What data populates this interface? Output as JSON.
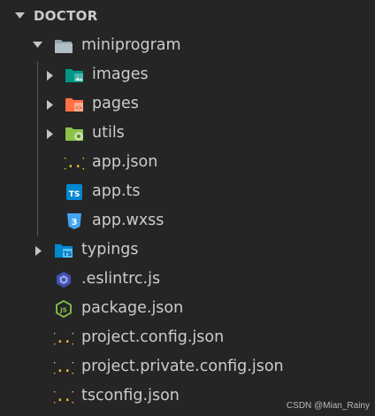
{
  "explorer": {
    "root_label": "DOCTOR",
    "items": [
      {
        "label": "miniprogram",
        "icon": "folder-open-icon"
      },
      {
        "label": "images",
        "icon": "folder-images-icon"
      },
      {
        "label": "pages",
        "icon": "folder-pages-icon"
      },
      {
        "label": "utils",
        "icon": "folder-utils-icon"
      },
      {
        "label": "app.json",
        "icon": "json-icon"
      },
      {
        "label": "app.ts",
        "icon": "typescript-icon"
      },
      {
        "label": "app.wxss",
        "icon": "css-icon"
      },
      {
        "label": "typings",
        "icon": "folder-typescript-icon"
      },
      {
        "label": ".eslintrc.js",
        "icon": "eslint-icon"
      },
      {
        "label": "package.json",
        "icon": "nodejs-icon"
      },
      {
        "label": "project.config.json",
        "icon": "json-icon"
      },
      {
        "label": "project.private.config.json",
        "icon": "json-icon"
      },
      {
        "label": "tsconfig.json",
        "icon": "json-icon"
      }
    ]
  },
  "watermark": "CSDN @Mian_Rainy"
}
